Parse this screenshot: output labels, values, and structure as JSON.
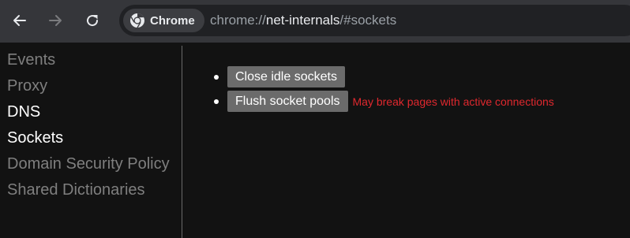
{
  "toolbar": {
    "back_icon": "arrow-left-icon",
    "forward_icon": "arrow-right-icon",
    "reload_icon": "reload-icon"
  },
  "omnibox": {
    "chip_label": "Chrome",
    "chip_icon": "chrome-logo-icon",
    "url_scheme": "chrome://",
    "url_host": "net-internals",
    "url_path": "/#sockets"
  },
  "sidebar": {
    "items": [
      {
        "label": "Events",
        "active": false
      },
      {
        "label": "Proxy",
        "active": false
      },
      {
        "label": "DNS",
        "active": true
      },
      {
        "label": "Sockets",
        "active": true
      },
      {
        "label": "Domain Security Policy",
        "active": false
      },
      {
        "label": "Shared Dictionaries",
        "active": false
      }
    ]
  },
  "content": {
    "close_idle_label": "Close idle sockets",
    "flush_pools_label": "Flush socket pools",
    "flush_warning": "May break pages with active connections"
  },
  "colors": {
    "toolbar_bg": "#35363a",
    "page_bg": "#121212",
    "button_bg": "#6b6b6b",
    "warning_text": "#e0282e"
  }
}
